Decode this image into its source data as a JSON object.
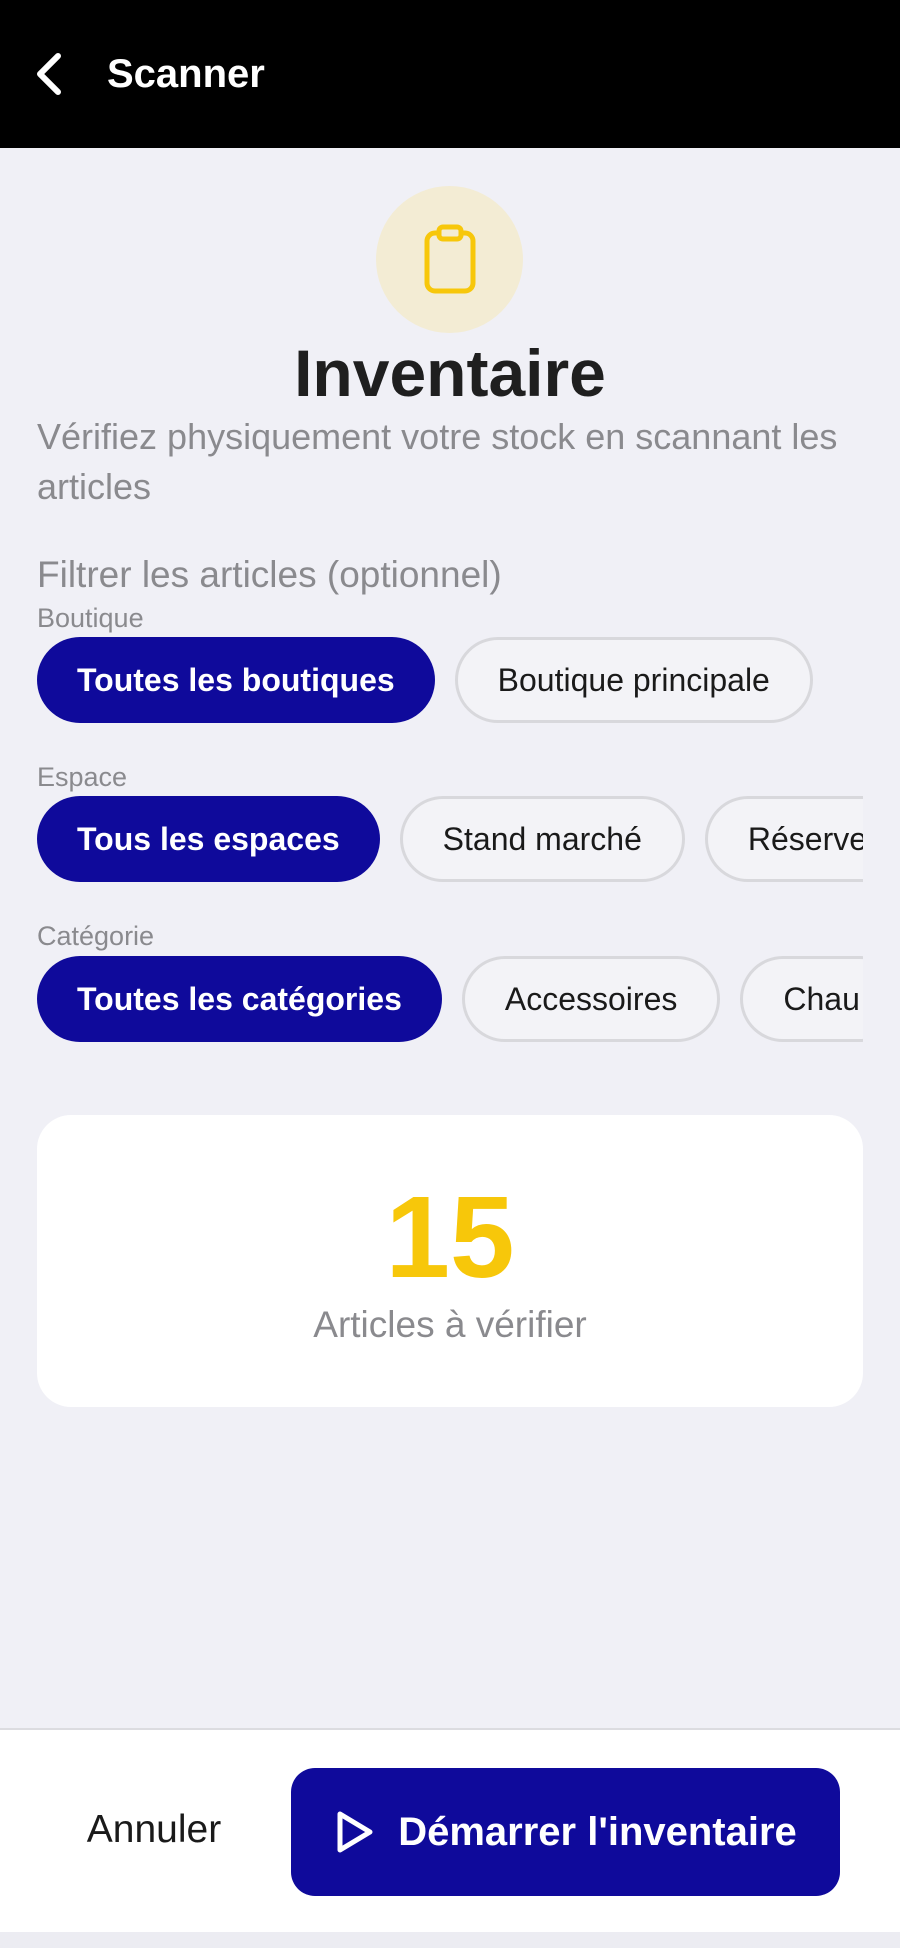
{
  "header": {
    "title": "Scanner",
    "back_icon": "chevron-left-icon"
  },
  "hero": {
    "icon": "clipboard-icon",
    "icon_color": "#f7c70a",
    "icon_bg": "#f3ecd4",
    "title": "Inventaire",
    "subtitle": "Vérifiez physiquement votre stock en scannant les articles"
  },
  "filters": {
    "heading": "Filtrer les articles (optionnel)",
    "groups": [
      {
        "label": "Boutique",
        "chips": [
          {
            "label": "Toutes les boutiques",
            "selected": true
          },
          {
            "label": "Boutique principale",
            "selected": false
          }
        ]
      },
      {
        "label": "Espace",
        "chips": [
          {
            "label": "Tous les espaces",
            "selected": true
          },
          {
            "label": "Stand marché",
            "selected": false
          },
          {
            "label": "Réserve",
            "selected": false
          }
        ]
      },
      {
        "label": "Catégorie",
        "chips": [
          {
            "label": "Toutes les catégories",
            "selected": true
          },
          {
            "label": "Accessoires",
            "selected": false
          },
          {
            "label": "Chau",
            "selected": false
          }
        ]
      }
    ]
  },
  "summary": {
    "count": "15",
    "label": "Articles à vérifier"
  },
  "footer": {
    "cancel_label": "Annuler",
    "start_label": "Démarrer l'inventaire",
    "start_icon": "play-icon"
  },
  "colors": {
    "primary": "#0f0a9b",
    "accent": "#f7c70a",
    "background": "#f0f0f6"
  }
}
